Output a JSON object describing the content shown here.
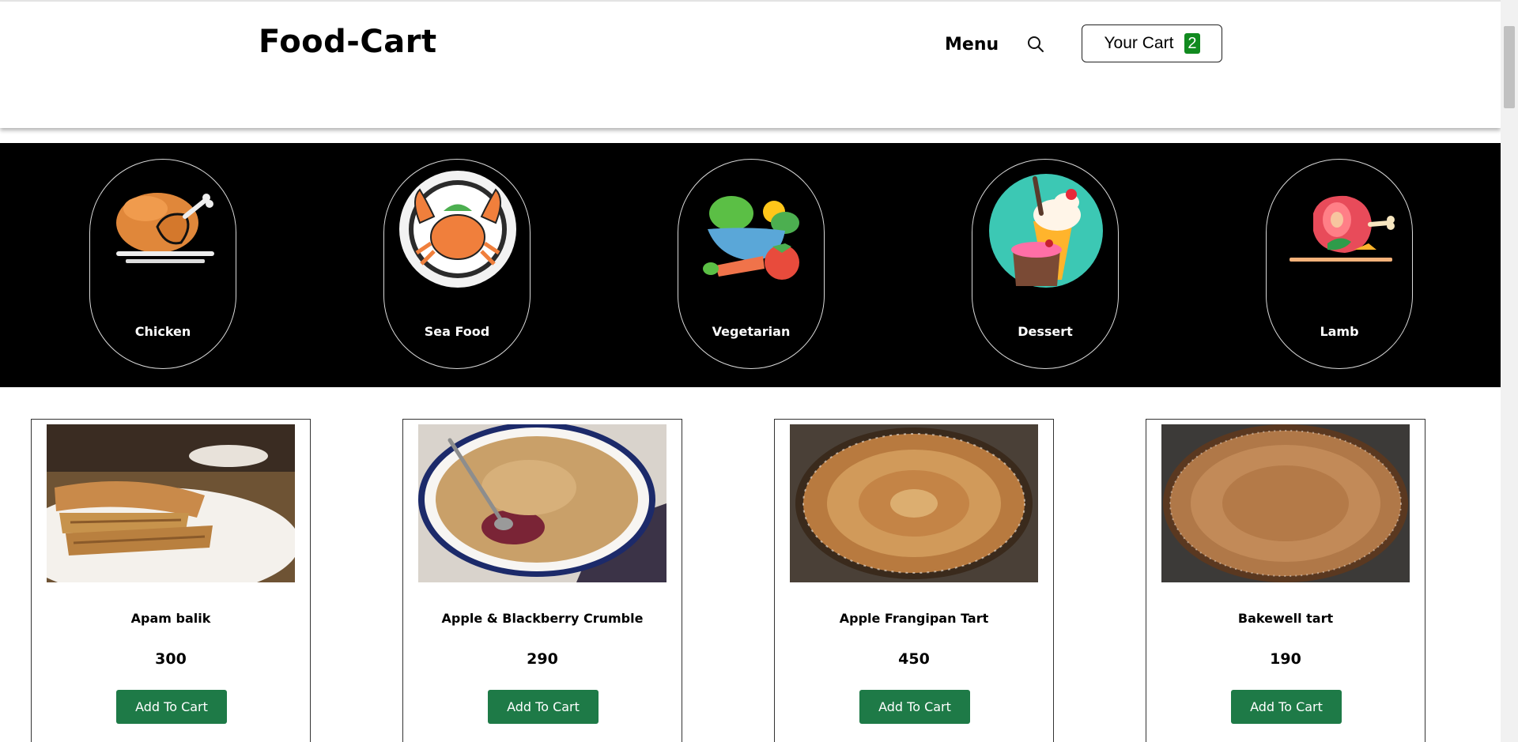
{
  "header": {
    "brand": "Food-Cart",
    "menu_label": "Menu",
    "search_icon": "search-icon",
    "cart_label": "Your Cart",
    "cart_count": "2"
  },
  "categories": [
    {
      "label": "Chicken",
      "icon": "roast-chicken-icon"
    },
    {
      "label": "Sea Food",
      "icon": "crab-plate-icon"
    },
    {
      "label": "Vegetarian",
      "icon": "vegetables-icon"
    },
    {
      "label": "Dessert",
      "icon": "dessert-icon"
    },
    {
      "label": "Lamb",
      "icon": "lamb-roast-icon"
    }
  ],
  "products": [
    {
      "name": "Apam balik",
      "price": "300",
      "button": "Add To Cart"
    },
    {
      "name": "Apple & Blackberry Crumble",
      "price": "290",
      "button": "Add To Cart"
    },
    {
      "name": "Apple Frangipan Tart",
      "price": "450",
      "button": "Add To Cart"
    },
    {
      "name": "Bakewell tart",
      "price": "190",
      "button": "Add To Cart"
    }
  ],
  "colors": {
    "cart_badge": "#118a1f",
    "add_button": "#1e7a47",
    "category_band": "#000000"
  }
}
